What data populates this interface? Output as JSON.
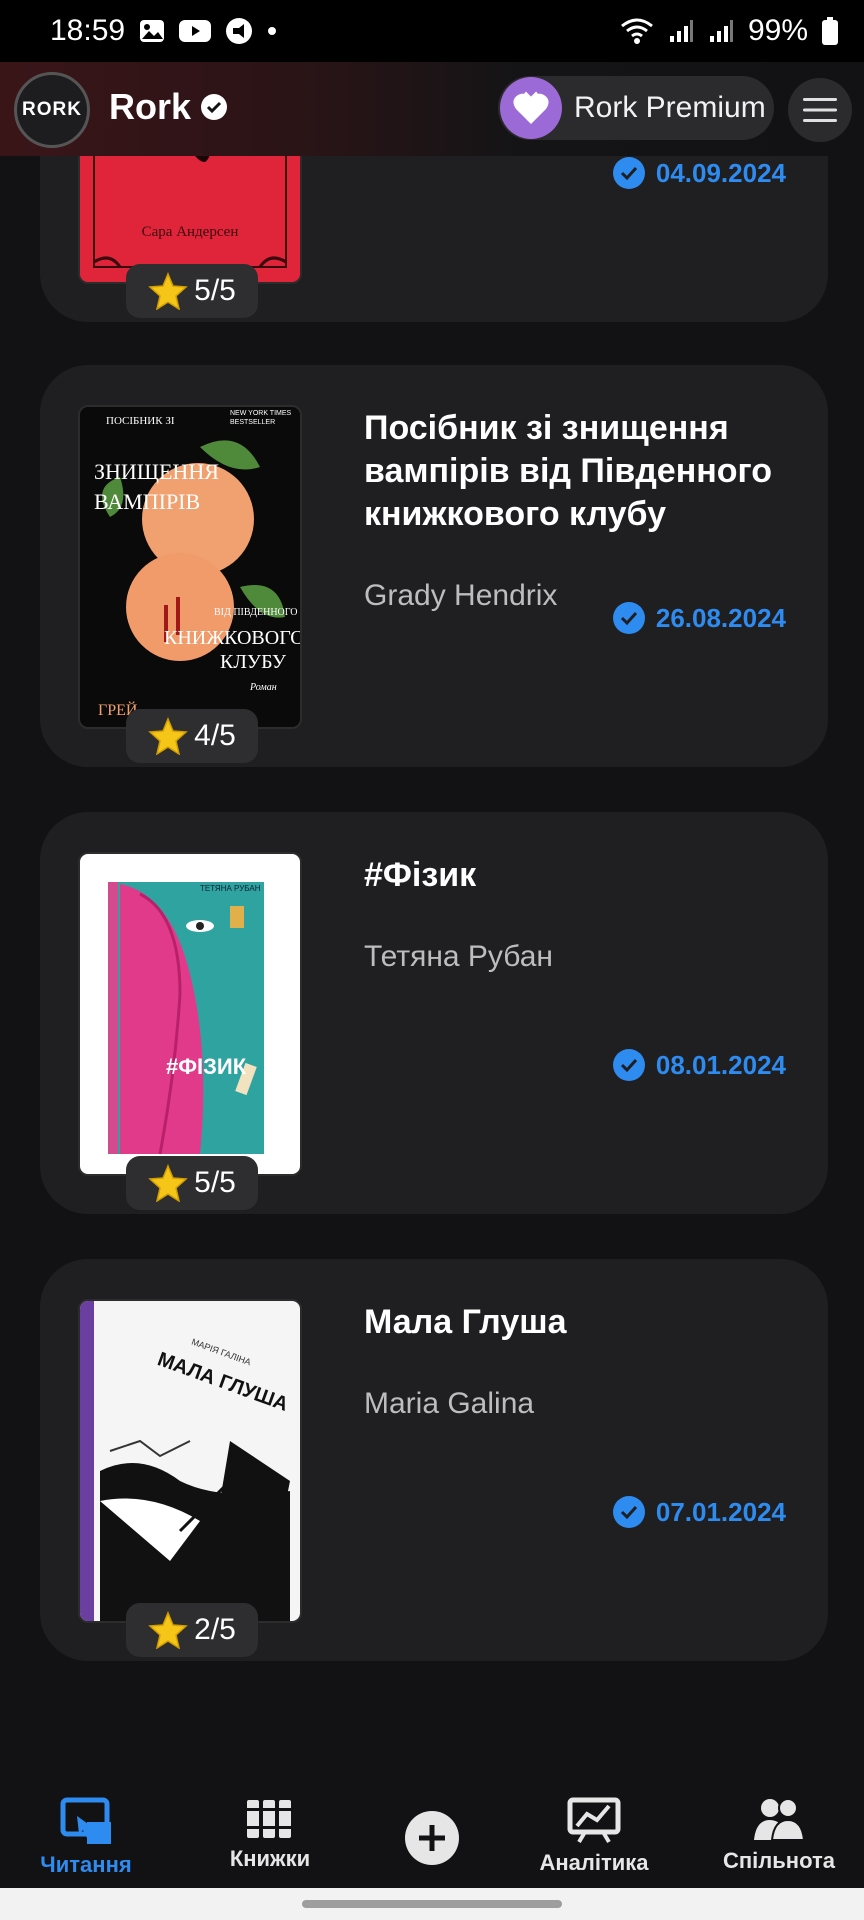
{
  "status_bar": {
    "time": "18:59",
    "battery": "99%"
  },
  "header": {
    "app_name": "Rork",
    "logo_text": "RORK",
    "premium_label": "Rork Premium"
  },
  "books": [
    {
      "title": "",
      "author": "",
      "cover_author": "Сара Андерсен",
      "rating": "5/5",
      "date": "04.09.2024"
    },
    {
      "title": "Посібник зі знищення вампірів від Південного книжкового клубу",
      "author": "Grady Hendrix",
      "rating": "4/5",
      "date": "26.08.2024",
      "cover_lines": [
        "ПОСІБНИК ЗІ",
        "ЗНИЩЕННЯ",
        "ВАМПІРІВ",
        "ВІД ПІВДЕННОГО",
        "КНИЖКОВОГО",
        "КЛУБУ",
        "Роман",
        "ГРЕЙ",
        "NEW YORK TIMES BESTSELLER"
      ]
    },
    {
      "title": "#Фізик",
      "author": "Тетяна Рубан",
      "rating": "5/5",
      "date": "08.01.2024",
      "cover_title": "#ФІЗИК",
      "cover_author": "ТЕТЯНА РУБАН"
    },
    {
      "title": "Мала Глуша",
      "author": "Maria Galina",
      "rating": "2/5",
      "date": "07.01.2024",
      "cover_title": "МАЛА ГЛУША",
      "cover_author": "МАРІЯ ГАЛІНА"
    }
  ],
  "nav": [
    {
      "label": "Читання",
      "icon": "reading-icon",
      "active": true
    },
    {
      "label": "Книжки",
      "icon": "books-icon"
    },
    {
      "label": "",
      "icon": "add-icon"
    },
    {
      "label": "Аналітика",
      "icon": "analytics-icon"
    },
    {
      "label": "Спільнота",
      "icon": "community-icon"
    }
  ],
  "colors": {
    "accent": "#2e8bf0",
    "card": "#1f1f21",
    "background": "#121214",
    "premium": "#9c6ad6"
  }
}
